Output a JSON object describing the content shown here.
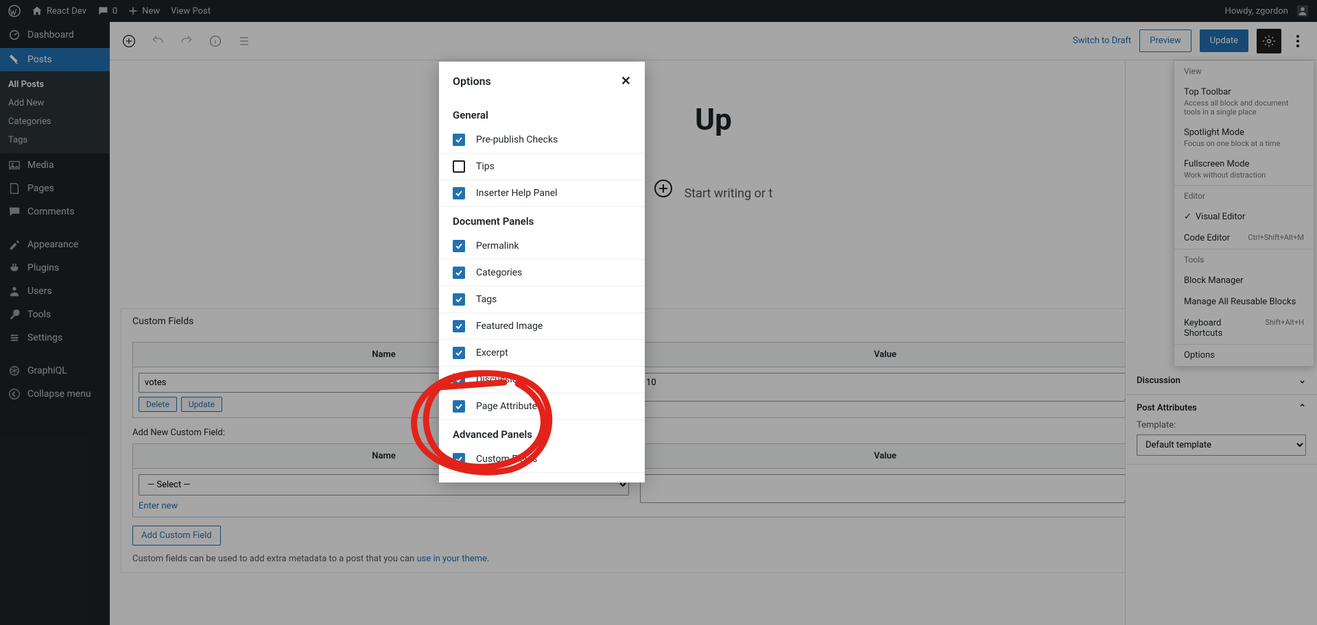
{
  "adminbar": {
    "site_name": "React Dev",
    "comments_count": "0",
    "new_label": "New",
    "view_post": "View Post",
    "howdy": "Howdy, zgordon"
  },
  "sidebar": {
    "dashboard": "Dashboard",
    "posts": "Posts",
    "posts_sub": {
      "all": "All Posts",
      "add": "Add New",
      "categories": "Categories",
      "tags": "Tags"
    },
    "media": "Media",
    "pages": "Pages",
    "comments": "Comments",
    "appearance": "Appearance",
    "plugins": "Plugins",
    "users": "Users",
    "tools": "Tools",
    "settings": "Settings",
    "graphiql": "GraphiQL",
    "collapse": "Collapse menu"
  },
  "topbar": {
    "switch_draft": "Switch to Draft",
    "preview": "Preview",
    "update": "Update"
  },
  "editor": {
    "title_visible": "Up",
    "prompt_visible": "Start writing or t"
  },
  "metabox": {
    "title": "Custom Fields",
    "name_hdr": "Name",
    "value_hdr": "Value",
    "field_name": "votes",
    "field_value": "10",
    "delete": "Delete",
    "update": "Update",
    "add_label": "Add New Custom Field:",
    "select_placeholder": "— Select —",
    "enter_new": "Enter new",
    "add_btn": "Add Custom Field",
    "note_pre": "Custom fields can be used to add extra metadata to a post that you can ",
    "note_link": "use in your theme"
  },
  "settings_panel": {
    "discussion": "Discussion",
    "post_attributes": "Post Attributes",
    "template_label": "Template:",
    "template_value": "Default template"
  },
  "more_menu": {
    "view_hdr": "View",
    "top_toolbar": "Top Toolbar",
    "top_toolbar_sub": "Access all block and document tools in a single place",
    "spotlight": "Spotlight Mode",
    "spotlight_sub": "Focus on one block at a time",
    "fullscreen": "Fullscreen Mode",
    "fullscreen_sub": "Work without distraction",
    "editor_hdr": "Editor",
    "visual": "Visual Editor",
    "code": "Code Editor",
    "code_kbd": "Ctrl+Shift+Alt+M",
    "tools_hdr": "Tools",
    "block_manager": "Block Manager",
    "reusable": "Manage All Reusable Blocks",
    "shortcuts": "Keyboard Shortcuts",
    "shortcuts_kbd": "Shift+Alt+H",
    "options": "Options"
  },
  "modal": {
    "title": "Options",
    "general_hdr": "General",
    "prepublish": "Pre-publish Checks",
    "tips": "Tips",
    "inserter": "Inserter Help Panel",
    "doc_panels_hdr": "Document Panels",
    "permalink": "Permalink",
    "categories": "Categories",
    "tags": "Tags",
    "featured": "Featured Image",
    "excerpt": "Excerpt",
    "discussion": "Discussion",
    "page_attr": "Page Attributes",
    "adv_panels_hdr": "Advanced Panels",
    "custom_fields": "Custom Fields"
  }
}
